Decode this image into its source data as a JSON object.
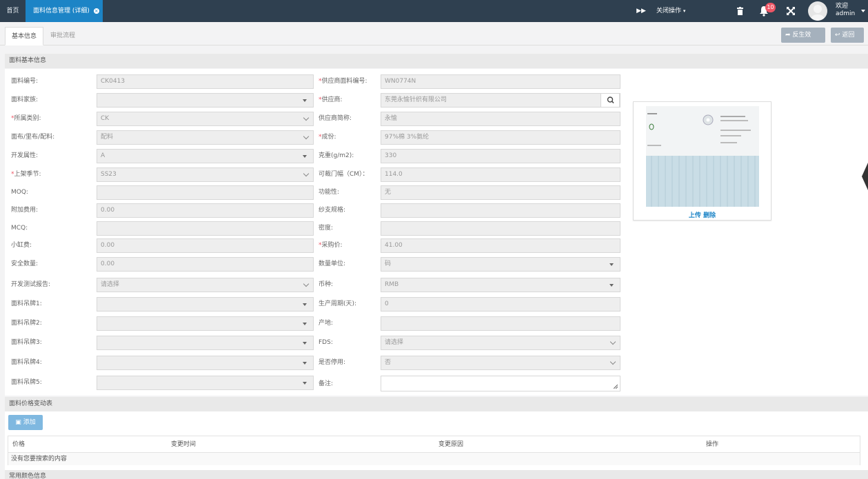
{
  "topbar": {
    "home": "首页",
    "active_tab": "面料信息管理 (详细)",
    "close_ops": "关闭操作",
    "notification_count": "10",
    "welcome": "欢迎",
    "username": "admin"
  },
  "tabs": [
    {
      "label": "基本信息"
    },
    {
      "label": "审批流程"
    }
  ],
  "actions": {
    "unpublish": "反生效",
    "back": "返回"
  },
  "sections": {
    "basic": "面料基本信息",
    "price_changes": "面料价格变动表",
    "colors": "常用颜色信息"
  },
  "left_fields": [
    {
      "label": "面料编号:",
      "value": "CK0413",
      "required": false
    },
    {
      "label": "面料家族:",
      "value": "",
      "required": false
    },
    {
      "label": "所属类别:",
      "value": "CK",
      "required": true
    },
    {
      "label": "面布/里布/配料:",
      "value": "配料",
      "required": false
    },
    {
      "label": "开发属性:",
      "value": "A",
      "required": false
    },
    {
      "label": "上架季节:",
      "value": "SS23",
      "required": true
    },
    {
      "label": "MOQ:",
      "value": "",
      "required": false
    },
    {
      "label": "附加费用:",
      "value": "0.00",
      "required": false
    },
    {
      "label": "MCQ:",
      "value": "",
      "required": false
    },
    {
      "label": "小缸费:",
      "value": "0.00",
      "required": false
    },
    {
      "label": "安全数量:",
      "value": "0.00",
      "required": false
    },
    {
      "label": "开发测试报告:",
      "value": "请选择",
      "required": false
    },
    {
      "label": "面料吊牌1:",
      "value": "",
      "required": false
    },
    {
      "label": "面料吊牌2:",
      "value": "",
      "required": false
    },
    {
      "label": "面料吊牌3:",
      "value": "",
      "required": false
    },
    {
      "label": "面料吊牌4:",
      "value": "",
      "required": false
    },
    {
      "label": "面料吊牌5:",
      "value": "",
      "required": false
    }
  ],
  "right_fields": [
    {
      "label": "供应商面料编号:",
      "value": "WN0774N",
      "required": true
    },
    {
      "label": "供应商:",
      "value": "东莞永愉针织有限公司",
      "required": true
    },
    {
      "label": "供应商简称:",
      "value": "永愉",
      "required": false
    },
    {
      "label": "成份:",
      "value": "97%棉 3%氨纶",
      "required": true
    },
    {
      "label": "克重(g/m2):",
      "value": "330",
      "required": false
    },
    {
      "label": "可裁门幅（CM）：",
      "value": "114.0",
      "required": false
    },
    {
      "label": "功能性:",
      "value": "无",
      "required": false
    },
    {
      "label": "纱支规格:",
      "value": "",
      "required": false
    },
    {
      "label": "密度:",
      "value": "",
      "required": false
    },
    {
      "label": "采购价:",
      "value": "41.00",
      "required": true
    },
    {
      "label": "数量单位:",
      "value": "码",
      "required": false
    },
    {
      "label": "币种:",
      "value": "RMB",
      "required": false
    },
    {
      "label": "生产周期(天):",
      "value": "0",
      "required": false
    },
    {
      "label": "产地:",
      "value": "",
      "required": false
    },
    {
      "label": "FDS:",
      "value": "请选择",
      "required": false
    },
    {
      "label": "是否停用:",
      "value": "否",
      "required": false
    },
    {
      "label": "备注:",
      "value": "",
      "required": false
    }
  ],
  "image": {
    "upload": "上传",
    "delete": "删除"
  },
  "price_table": {
    "add_button": "添加",
    "columns": [
      "价格",
      "变更时间",
      "变更原因",
      "操作"
    ],
    "empty_text": "没有您要搜索的内容"
  }
}
